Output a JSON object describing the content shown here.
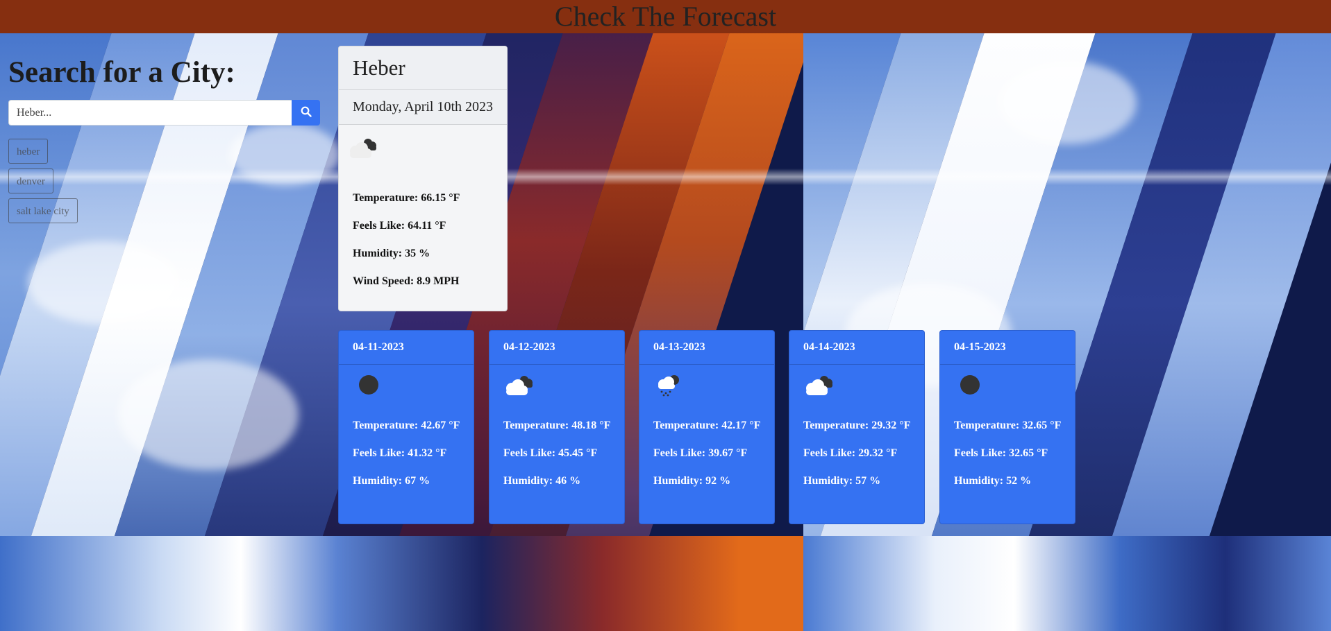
{
  "header": {
    "title": "Check The Forecast"
  },
  "search": {
    "title": "Search for a City:",
    "placeholder": "Heber...",
    "history": [
      "heber",
      "denver",
      "salt lake city"
    ]
  },
  "current": {
    "city": "Heber",
    "date": "Monday, April 10th 2023",
    "icon": "broken-clouds-icon",
    "temperature": "Temperature: 66.15 °F",
    "feels_like": "Feels Like: 64.11 °F",
    "humidity": "Humidity: 35 %",
    "wind": "Wind Speed: 8.9 MPH"
  },
  "forecast": [
    {
      "date": "04-11-2023",
      "icon": "clear-night-icon",
      "temperature": "Temperature: 42.67 °F",
      "feels_like": "Feels Like: 41.32 °F",
      "humidity": "Humidity: 67 %"
    },
    {
      "date": "04-12-2023",
      "icon": "broken-clouds-icon",
      "temperature": "Temperature: 48.18 °F",
      "feels_like": "Feels Like: 45.45 °F",
      "humidity": "Humidity: 46 %"
    },
    {
      "date": "04-13-2023",
      "icon": "snow-icon",
      "temperature": "Temperature: 42.17 °F",
      "feels_like": "Feels Like: 39.67 °F",
      "humidity": "Humidity: 92 %"
    },
    {
      "date": "04-14-2023",
      "icon": "broken-clouds-icon",
      "temperature": "Temperature: 29.32 °F",
      "feels_like": "Feels Like: 29.32 °F",
      "humidity": "Humidity: 57 %"
    },
    {
      "date": "04-15-2023",
      "icon": "clear-night-icon",
      "temperature": "Temperature: 32.65 °F",
      "feels_like": "Feels Like: 32.65 °F",
      "humidity": "Humidity: 52 %"
    }
  ],
  "colors": {
    "header": "#862f10",
    "accent": "#3572f2",
    "card": "#f4f5f7"
  }
}
